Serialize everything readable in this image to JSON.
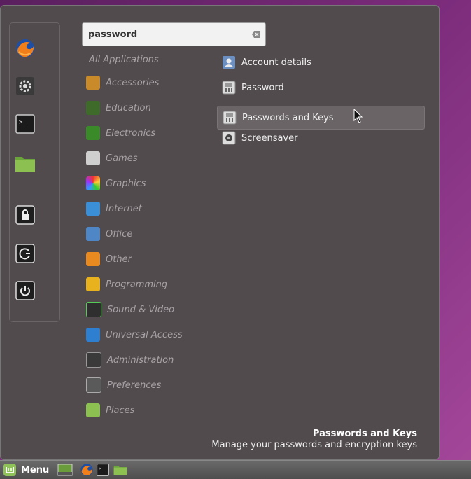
{
  "search": {
    "query": "password"
  },
  "categories": [
    {
      "label": "All Applications"
    },
    {
      "label": "Accessories"
    },
    {
      "label": "Education"
    },
    {
      "label": "Electronics"
    },
    {
      "label": "Games"
    },
    {
      "label": "Graphics"
    },
    {
      "label": "Internet"
    },
    {
      "label": "Office"
    },
    {
      "label": "Other"
    },
    {
      "label": "Programming"
    },
    {
      "label": "Sound & Video"
    },
    {
      "label": "Universal Access"
    },
    {
      "label": "Administration"
    },
    {
      "label": "Preferences"
    },
    {
      "label": "Places"
    }
  ],
  "results": [
    {
      "label": "Account details"
    },
    {
      "label": "Password"
    },
    {
      "label": "Passwords and Keys"
    },
    {
      "label": "Screensaver"
    }
  ],
  "description": {
    "title": "Passwords and Keys",
    "text": "Manage your passwords and encryption keys"
  },
  "panel": {
    "menu_label": "Menu"
  },
  "favorites": [
    {
      "icon": "firefox-icon"
    },
    {
      "icon": "settings-icon"
    },
    {
      "icon": "terminal-icon"
    },
    {
      "icon": "folder-icon"
    },
    {
      "icon": "lock-screen-icon"
    },
    {
      "icon": "logout-icon"
    },
    {
      "icon": "power-icon"
    }
  ]
}
